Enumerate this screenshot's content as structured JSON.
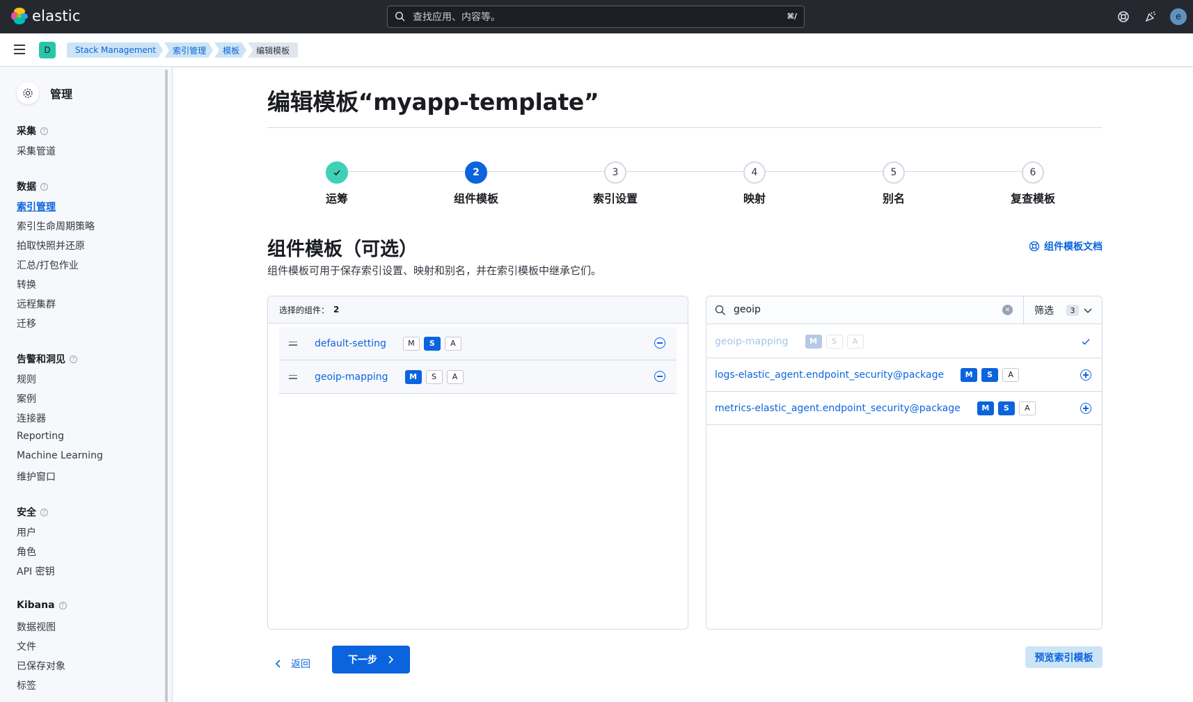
{
  "header": {
    "brand": "elastic",
    "search_placeholder": "查找应用、内容等。",
    "search_shortcut": "⌘/",
    "avatar_initial": "e"
  },
  "nav": {
    "space_initial": "D",
    "breadcrumbs": [
      "Stack Management",
      "索引管理",
      "模板",
      "编辑模板"
    ]
  },
  "sidebar": {
    "title": "管理",
    "sections": [
      {
        "title": "采集",
        "items": [
          "采集管道"
        ]
      },
      {
        "title": "数据",
        "items": [
          "索引管理",
          "索引生命周期策略",
          "拍取快照并还原",
          "汇总/打包作业",
          "转换",
          "远程集群",
          "迁移"
        ]
      },
      {
        "title": "告警和洞见",
        "items": [
          "规则",
          "案例",
          "连接器",
          "Reporting",
          "Machine Learning",
          "维护窗口"
        ]
      },
      {
        "title": "安全",
        "items": [
          "用户",
          "角色",
          "API 密钥"
        ]
      },
      {
        "title": "Kibana",
        "items": [
          "数据视图",
          "文件",
          "已保存对象",
          "标签"
        ]
      }
    ],
    "active_item": "索引管理"
  },
  "page": {
    "title": "编辑模板“myapp-template”"
  },
  "steps": [
    {
      "number": "1",
      "label": "运筹",
      "status": "complete"
    },
    {
      "number": "2",
      "label": "组件模板",
      "status": "current"
    },
    {
      "number": "3",
      "label": "索引设置",
      "status": "upcoming"
    },
    {
      "number": "4",
      "label": "映射",
      "status": "upcoming"
    },
    {
      "number": "5",
      "label": "别名",
      "status": "upcoming"
    },
    {
      "number": "6",
      "label": "复查模板",
      "status": "upcoming"
    }
  ],
  "section": {
    "title": "组件模板（可选）",
    "description": "组件模板可用于保存索引设置、映射和别名，并在索引模板中继承它们。",
    "doc_link": "组件模板文档"
  },
  "selected_panel": {
    "header_label": "选择的组件：",
    "count": "2",
    "items": [
      {
        "name": "default-setting",
        "badges": [
          {
            "label": "M",
            "on": false
          },
          {
            "label": "S",
            "on": true
          },
          {
            "label": "A",
            "on": false
          }
        ]
      },
      {
        "name": "geoip-mapping",
        "badges": [
          {
            "label": "M",
            "on": true
          },
          {
            "label": "S",
            "on": false
          },
          {
            "label": "A",
            "on": false
          }
        ]
      }
    ]
  },
  "available_panel": {
    "search_value": "geoip",
    "filter_label": "筛选",
    "filter_count": "3",
    "items": [
      {
        "name": "geoip-mapping",
        "selected": true,
        "badges": [
          {
            "label": "M",
            "on": true
          },
          {
            "label": "S",
            "on": false
          },
          {
            "label": "A",
            "on": false
          }
        ]
      },
      {
        "name": "logs-elastic_agent.endpoint_security@package",
        "selected": false,
        "badges": [
          {
            "label": "M",
            "on": true
          },
          {
            "label": "S",
            "on": true
          },
          {
            "label": "A",
            "on": false
          }
        ]
      },
      {
        "name": "metrics-elastic_agent.endpoint_security@package",
        "selected": false,
        "badges": [
          {
            "label": "M",
            "on": true
          },
          {
            "label": "S",
            "on": true
          },
          {
            "label": "A",
            "on": false
          }
        ]
      }
    ]
  },
  "footer": {
    "back_label": "返回",
    "next_label": "下一步",
    "preview_label": "预览索引模板"
  },
  "colors": {
    "primary": "#0b64dd",
    "success": "#3fd1b8",
    "header_bg": "#25282f"
  }
}
